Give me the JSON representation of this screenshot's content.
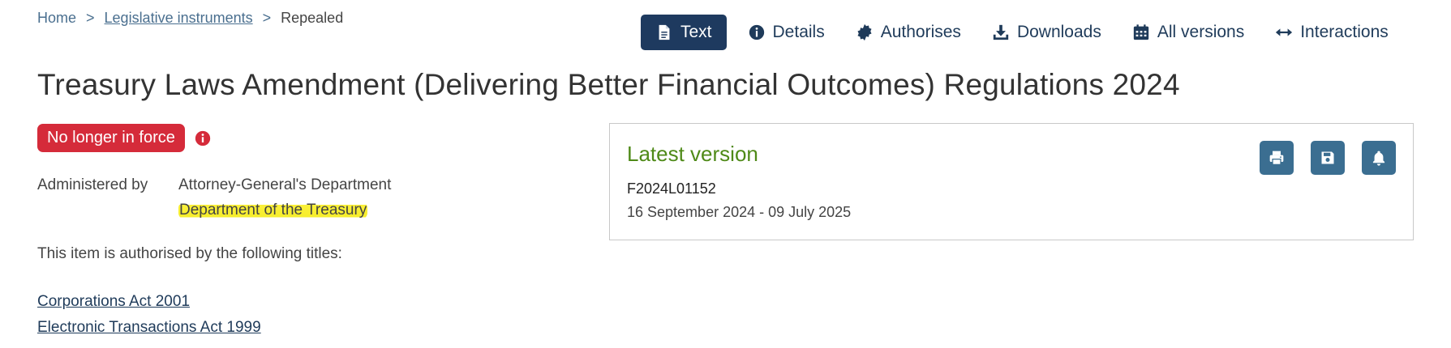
{
  "breadcrumb": {
    "home": "Home",
    "separator": ">",
    "section": "Legislative instruments",
    "current": "Repealed"
  },
  "tabs": [
    {
      "label": "Text",
      "icon": "document-icon",
      "active": true
    },
    {
      "label": "Details",
      "icon": "info-icon",
      "active": false
    },
    {
      "label": "Authorises",
      "icon": "seal-icon",
      "active": false
    },
    {
      "label": "Downloads",
      "icon": "download-icon",
      "active": false
    },
    {
      "label": "All versions",
      "icon": "calendar-icon",
      "active": false
    },
    {
      "label": "Interactions",
      "icon": "double-arrow-icon",
      "active": false
    }
  ],
  "title": "Treasury Laws Amendment (Delivering Better Financial Outcomes) Regulations 2024",
  "status": {
    "badge": "No longer in force",
    "badge_color": "#d52b3a",
    "info_icon": "info-icon"
  },
  "administered": {
    "label": "Administered by",
    "departments": [
      "Attorney-General's Department",
      "Department of the Treasury"
    ]
  },
  "authorised": {
    "text": "This item is authorised by the following titles:",
    "titles": [
      "Corporations Act 2001",
      "Electronic Transactions Act 1999"
    ]
  },
  "latest_version": {
    "heading": "Latest version",
    "id": "F2024L01152",
    "dates": "16 September 2024 - 09 July 2025",
    "buttons": [
      "print-icon",
      "save-icon",
      "bell-icon"
    ]
  },
  "colors": {
    "accent": "#1e3a5f",
    "latest_green": "#4f8a18",
    "button_blue": "#3b6e91",
    "highlight": "#fbf03a"
  }
}
